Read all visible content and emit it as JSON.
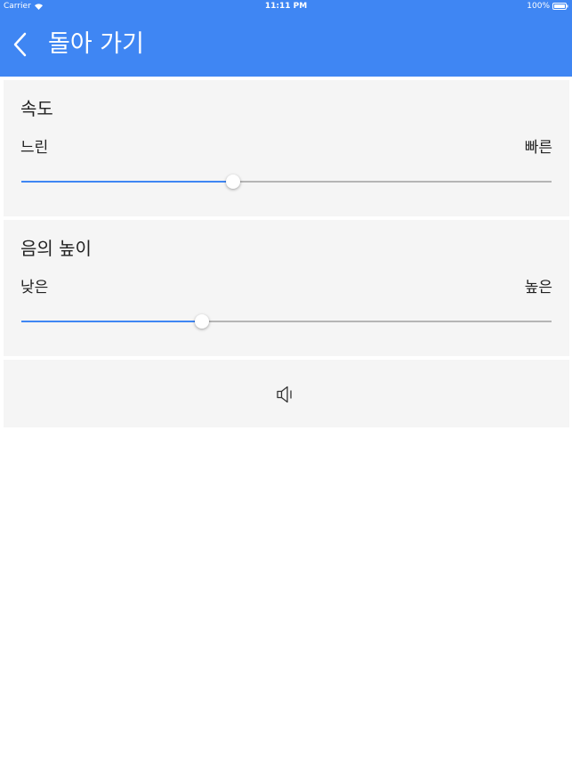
{
  "status_bar": {
    "carrier": "Carrier",
    "time": "11:11 PM",
    "battery": "100%",
    "wifi_icon": "wifi-icon",
    "battery_icon": "battery-icon"
  },
  "nav": {
    "back_icon": "chevron-left-icon",
    "title": "돌아 가기"
  },
  "speed": {
    "title": "속도",
    "min_label": "느린",
    "max_label": "빠른",
    "value": 0.4
  },
  "pitch": {
    "title": "음의 높이",
    "min_label": "낮은",
    "max_label": "높은",
    "value": 0.34
  },
  "play": {
    "icon": "speaker-icon"
  },
  "colors": {
    "accent": "#3f86f3",
    "card_background": "#f5f5f5",
    "track": "#b5b5b5"
  }
}
